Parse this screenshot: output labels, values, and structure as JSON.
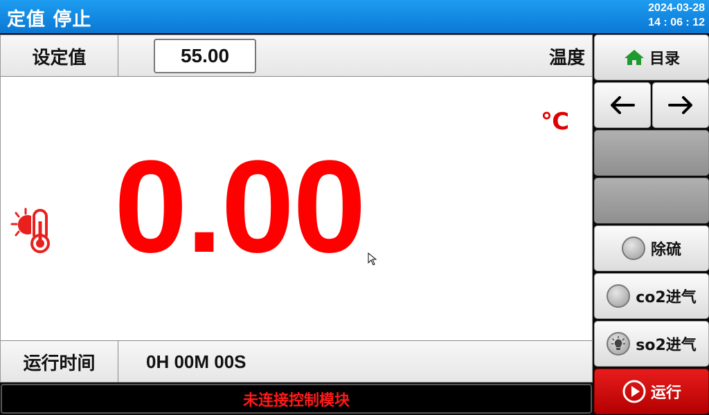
{
  "header": {
    "title": "定值 停止",
    "date": "2024-03-28",
    "time": "14 : 06 : 12"
  },
  "setpoint": {
    "label": "设定值",
    "value": "55.00",
    "name": "温度"
  },
  "display": {
    "value": "0.00",
    "unit": "℃"
  },
  "runtime": {
    "label": "运行时间",
    "value": "0H 00M 00S"
  },
  "status": {
    "message": "未连接控制模块"
  },
  "side": {
    "menu_label": "目录",
    "desulfurize_label": "除硫",
    "co2_label": "co2进气",
    "so2_label": "so2进气",
    "run_label": "运行"
  },
  "colors": {
    "accent": "#0b78d4",
    "value": "#ff0000",
    "run": "#d40000",
    "home_icon": "#1f9a2e"
  },
  "icons": {
    "menu": "home-icon",
    "prev": "arrow-left-icon",
    "next": "arrow-right-icon",
    "temperature": "thermometer-sun-icon",
    "run": "play-circle-icon"
  }
}
